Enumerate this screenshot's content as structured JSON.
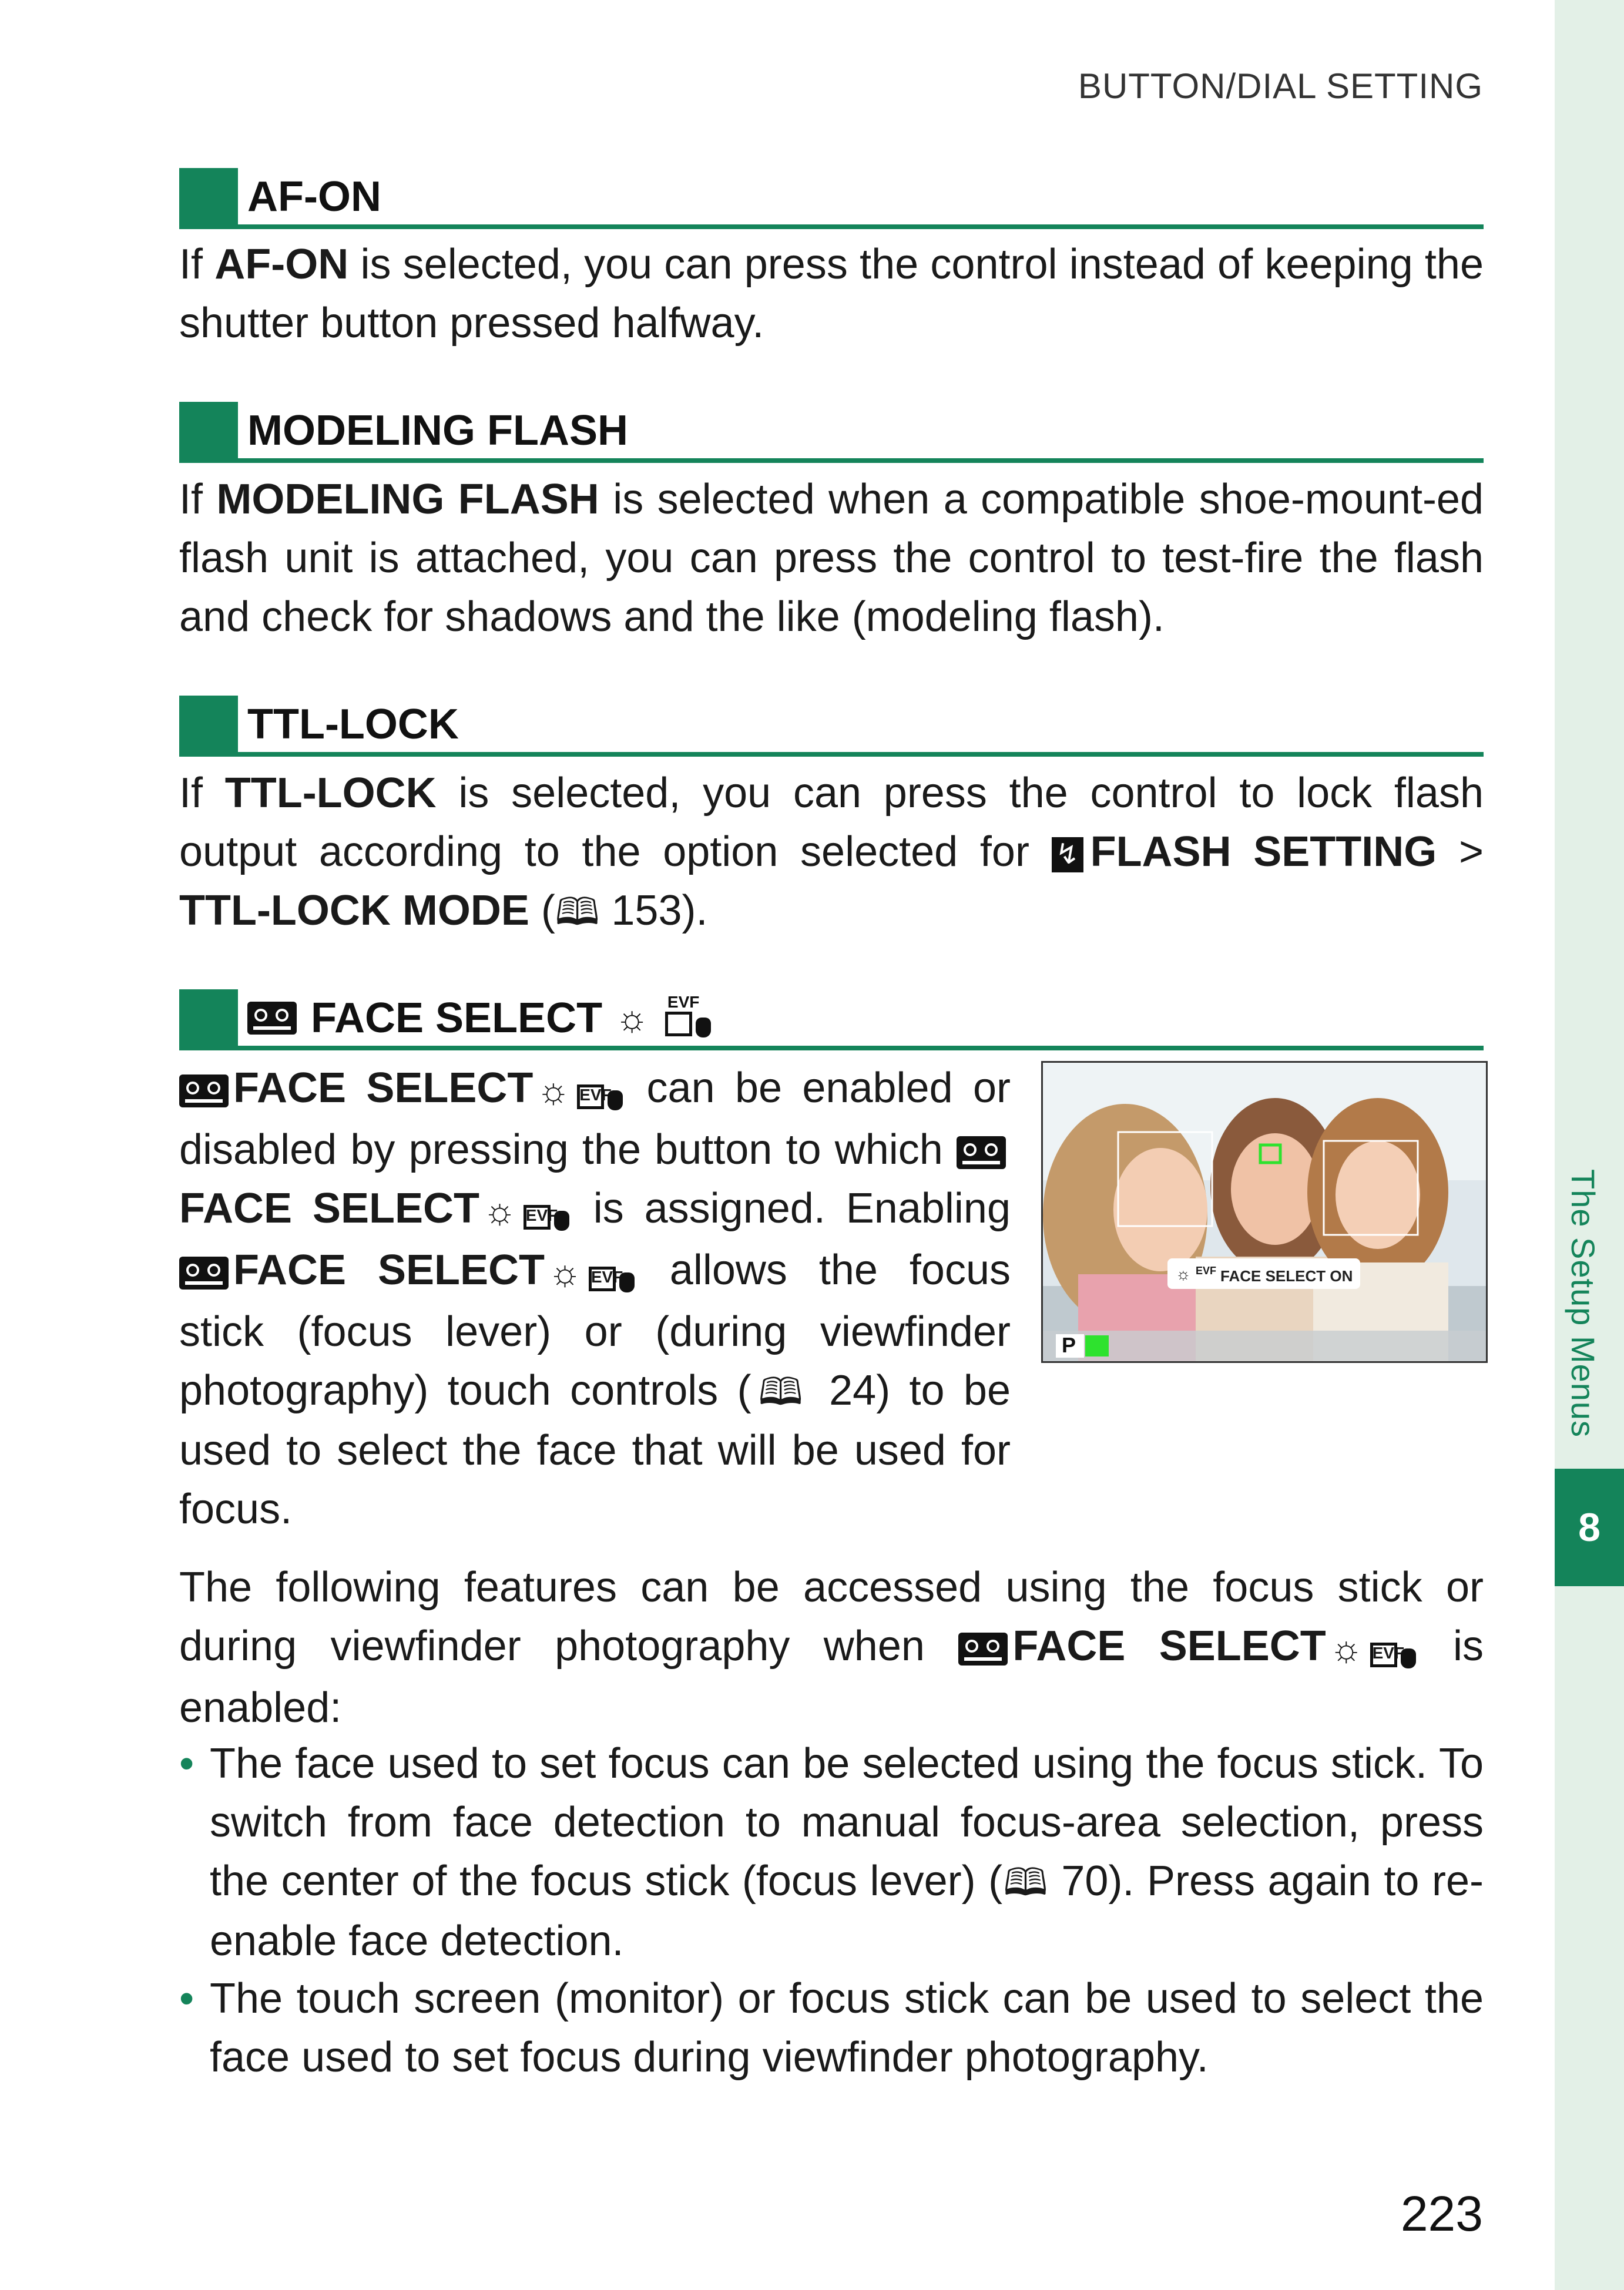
{
  "running_head": "BUTTON/DIAL SETTING",
  "sidebar": {
    "label": "The Setup Menus",
    "chapter": "8"
  },
  "sections": {
    "af_on": {
      "title": "AF-ON",
      "body": {
        "p1": "If ",
        "b1": "AF-ON",
        "p2": " is selected, you can press the control instead of keeping the shutter button pressed halfway."
      }
    },
    "modeling_flash": {
      "title": "MODELING FLASH",
      "body": {
        "p1": "If ",
        "b1": "MODELING FLASH",
        "p2": " is selected when a compatible shoe-mount-ed flash unit is attached, you can press the control to test-fire the flash and check for shadows and the like (modeling flash)."
      }
    },
    "ttl_lock": {
      "title": "TTL-LOCK",
      "body": {
        "p1": "If ",
        "b1": "TTL-LOCK",
        "p2": " is selected, you can press the control to lock flash output according to the option selected for ",
        "b2": "FLASH SETTING",
        "p3": " > ",
        "b3": "TTL-LOCK MODE",
        "p4": " (",
        "ref": "153",
        "p5": ")."
      }
    },
    "face_select": {
      "title": "FACE SELECT",
      "body": {
        "b1": "FACE SELECT",
        "p1": " can be enabled or disabled by pressing the button to which ",
        "b2": "FACE SELECT",
        "p2": " is assigned. Enabling ",
        "b3": "FACE SELECT",
        "p3": " allows the focus stick (focus lever) or (during viewfinder photography) touch controls (",
        "ref": "24",
        "p4": ") to be used to select the face that will be used for focus."
      },
      "intro": {
        "p1": "The following features can be accessed using the focus stick or during viewfinder photography when ",
        "b1": "FACE SELECT",
        "p2": " is enabled:"
      },
      "bullets": [
        {
          "p1": "The face used to set focus can be selected using the focus stick. To switch from face detection to manual focus-area selection, press the center of the focus stick (focus lever) (",
          "ref": "70",
          "p2": "). Press again to re-enable face detection."
        },
        {
          "p1": "The touch screen (monitor) or focus stick can be used to select the face used to set focus during viewfinder photography."
        }
      ]
    }
  },
  "photo": {
    "overlay_label": "FACE SELECT ON",
    "mode": "P",
    "evf_tag": "EVF"
  },
  "icons": {
    "face": "face-select-icon",
    "sun": "sun-icon",
    "evf": "evf-touch-icon",
    "book": "book-reference-icon",
    "flash": "flash-icon",
    "bullet": "bullet-dot"
  },
  "colors": {
    "accent": "#14845a",
    "sidebar_bg": "#e3f0e7"
  },
  "page_number": "223"
}
